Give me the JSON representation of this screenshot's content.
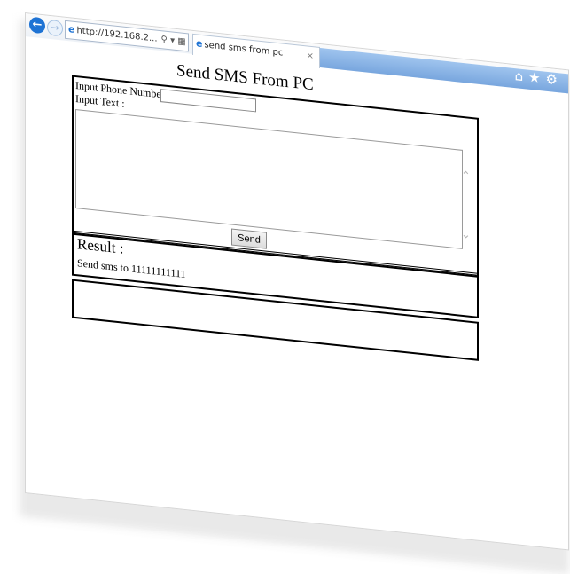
{
  "browser": {
    "address": "http://192.168.2...",
    "tab_title": "send sms from pc",
    "tab_close": "×"
  },
  "page": {
    "title": "Send SMS From PC",
    "phone_label": "Input Phone Number :",
    "phone_value": "",
    "text_label": "Input Text :",
    "text_value": "",
    "send_label": "Send",
    "result_title": "Result :",
    "result_text": "Send sms to 11111111111"
  }
}
